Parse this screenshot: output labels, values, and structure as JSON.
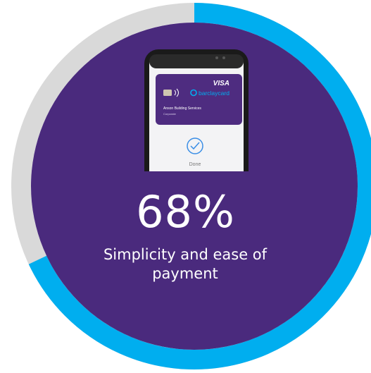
{
  "stat": {
    "value": "68%",
    "label": "Simplicity and ease of payment",
    "fraction": 0.68
  },
  "phone": {
    "card_network": "VISA",
    "card_brand": "barclaycard",
    "card_holder": "Anson Building Services",
    "card_type": "Corporate",
    "status_icon": "check-circle-icon",
    "status_text": "Done"
  },
  "colors": {
    "disc": "#4a2a7d",
    "progress": "#00aeef",
    "track": "#d9d9d9",
    "card": "#4e2c80"
  }
}
